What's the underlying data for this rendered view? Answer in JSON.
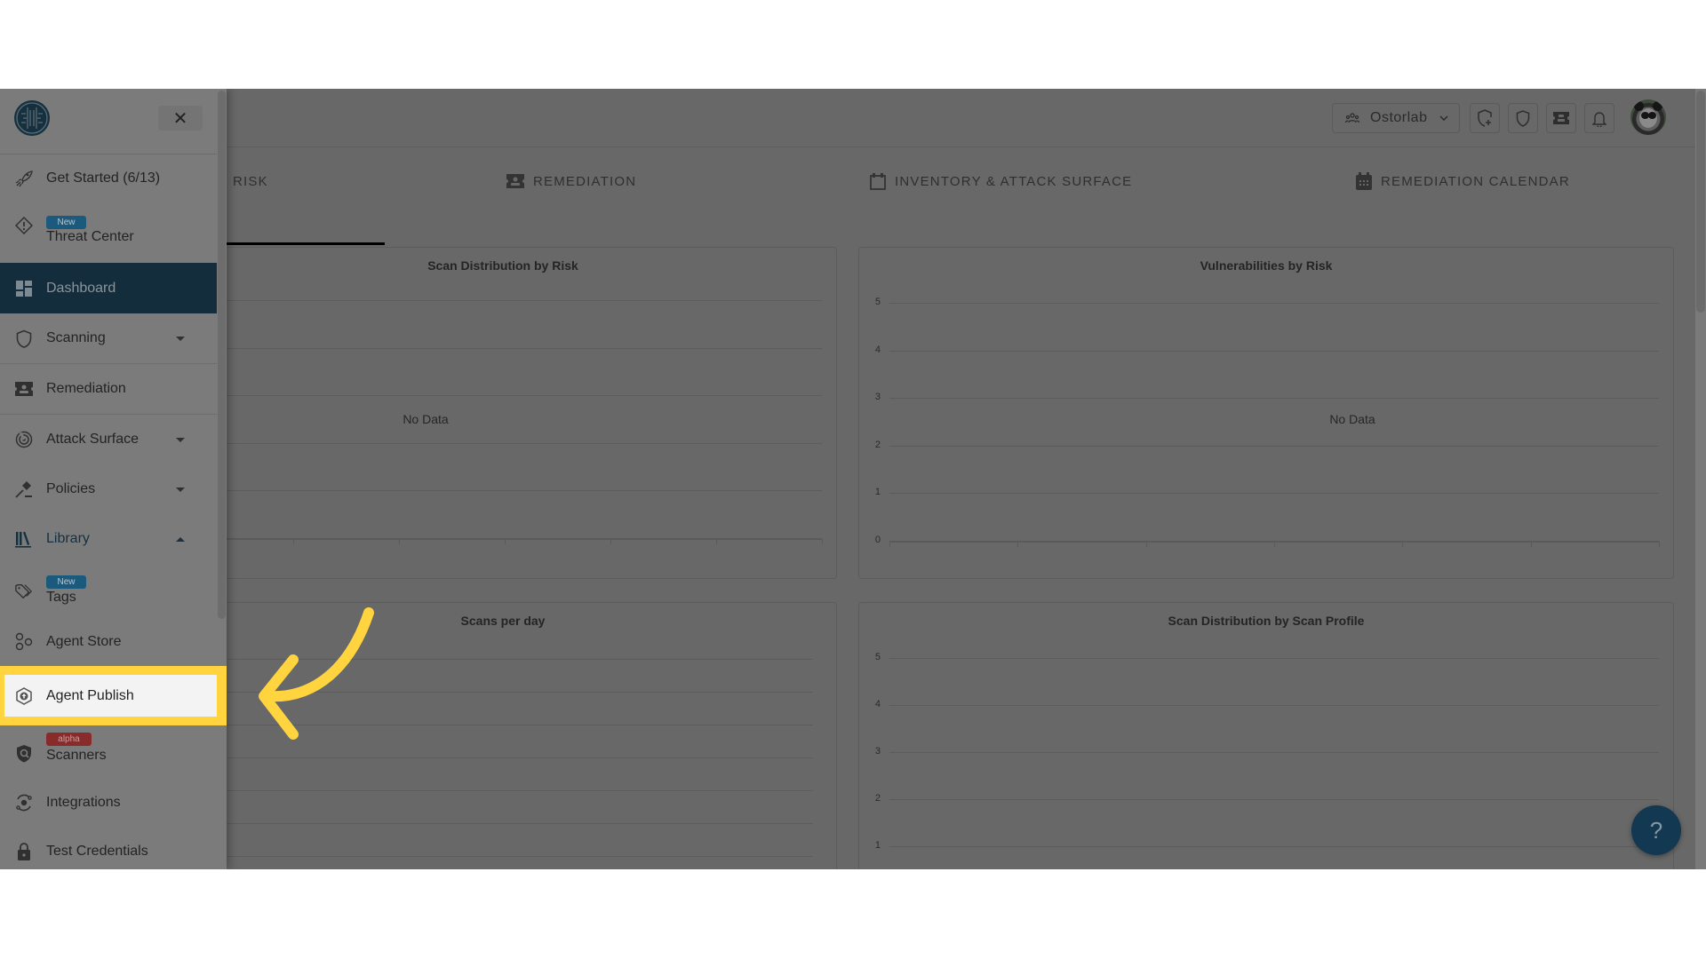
{
  "header": {
    "org_name": "Ostorlab",
    "buttons": [
      {
        "name": "add-scan-icon"
      },
      {
        "name": "shield-icon"
      },
      {
        "name": "ticket-icon"
      },
      {
        "name": "bell-icon"
      }
    ]
  },
  "tabs": [
    {
      "label": "Risk",
      "icon": "none",
      "active": true
    },
    {
      "label": "Remediation",
      "icon": "ticket-icon",
      "active": false
    },
    {
      "label": "Inventory & Attack Surface",
      "icon": "calendar-blank-icon",
      "active": false
    },
    {
      "label": "Remediation Calendar",
      "icon": "calendar-icon",
      "active": false
    }
  ],
  "sidebar": {
    "close_label": "✕",
    "items": [
      {
        "label": "Get Started (6/13)",
        "icon": "rocket-icon"
      },
      {
        "label": "Threat Center",
        "icon": "warning-diamond-icon",
        "badge": "New"
      },
      {
        "label": "Dashboard",
        "icon": "dashboard-icon",
        "active": true
      },
      {
        "label": "Scanning",
        "icon": "shield-icon",
        "expand": "down"
      },
      {
        "label": "Remediation",
        "icon": "ticket-icon"
      },
      {
        "label": "Attack Surface",
        "icon": "radar-icon",
        "expand": "down"
      },
      {
        "label": "Policies",
        "icon": "gavel-icon",
        "expand": "down"
      },
      {
        "label": "Library",
        "icon": "library-icon",
        "expand": "up"
      },
      {
        "label": "Tags",
        "icon": "tag-icon",
        "badge": "New"
      },
      {
        "label": "Agent Store",
        "icon": "agents-icon"
      },
      {
        "label": "Agent Publish",
        "icon": "publish-icon",
        "highlighted": true
      },
      {
        "label": "Scanners",
        "icon": "scanner-shield-icon",
        "badge": "alpha"
      },
      {
        "label": "Integrations",
        "icon": "integrations-icon"
      },
      {
        "label": "Test Credentials",
        "icon": "lock-icon"
      }
    ]
  },
  "colors": {
    "brand_dark": "#142d3d",
    "badge_new": "#1b5a7d",
    "badge_alpha": "#8a2b2b",
    "highlight": "#ffd43f",
    "help_button": "#133851"
  },
  "help_label": "?",
  "chart_data": [
    {
      "type": "bar",
      "title": "Scan Distribution by Risk",
      "categories": [],
      "values": [],
      "annotation": "No Data",
      "grid": true
    },
    {
      "type": "bar",
      "title": "Vulnerabilities by Risk",
      "categories": [],
      "values": [],
      "yticks": [
        "0",
        "1",
        "2",
        "3",
        "4",
        "5"
      ],
      "ylim": [
        0,
        5
      ],
      "annotation": "No Data",
      "grid": true
    },
    {
      "type": "line",
      "title": "Scans per day",
      "x": [],
      "values": [],
      "grid": true
    },
    {
      "type": "bar",
      "title": "Scan Distribution by Scan Profile",
      "categories": [],
      "values": [],
      "yticks": [
        "1",
        "2",
        "3",
        "4",
        "5"
      ],
      "ylim": [
        0,
        5
      ],
      "grid": true
    }
  ]
}
